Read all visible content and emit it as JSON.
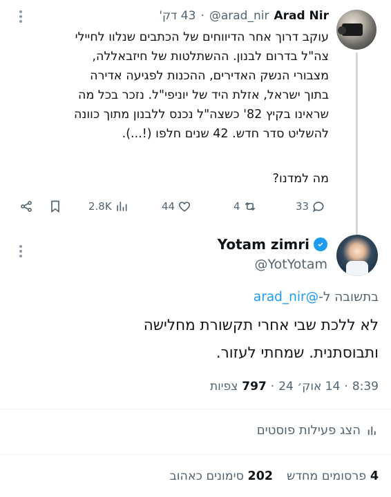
{
  "parent_tweet": {
    "author_name": "Arad Nir",
    "author_handle": "@arad_nir",
    "separator": "·",
    "time_ago": "43 דק'",
    "lines": [
      "עוקב דרוך אחר הדיווחים של הכתבים שנלוו לחיילי",
      "צה\"ל בדרום לבנון. ההשתלטות של חיזבאללה,",
      "מצבורי הנשק האדירים, ההכנות לפגיעה אדירה",
      "בתוך ישראל, אזלת היד של יוניפי\"ל. נזכר בכל מה",
      "שראינו בקיץ 82' כשצה\"ל נכנס ללבנון מתוך כוונה",
      "להשליט סדר חדש. 42 שנים חלפו (!...)."
    ],
    "question": "מה למדנו?",
    "actions": {
      "views": "2.8K",
      "likes": "44",
      "retweets": "4",
      "replies": "33"
    }
  },
  "reply_tweet": {
    "author_name": "Yotam zimri",
    "author_handle": "@YotYotam",
    "replying_prefix": "בתשובה ל-",
    "replying_mention": "@arad_nir",
    "lines": [
      "לא ללכת שבי אחרי תקשורת מחלישה",
      "ותבוסתנית. שמחתי לעזור."
    ],
    "time": "8:39",
    "date": "14 אוק׳ 24",
    "views_count": "797",
    "views_label": "צפיות",
    "analytics_label": "הצג פעילות פוסטים",
    "reposts_count": "4",
    "reposts_label": "פרסומים מחדש",
    "likes_count": "202",
    "likes_label": "סימונים כאהוב"
  },
  "colors": {
    "accent": "#1d9bf0",
    "text_primary": "#0f1419",
    "text_secondary": "#536471"
  }
}
